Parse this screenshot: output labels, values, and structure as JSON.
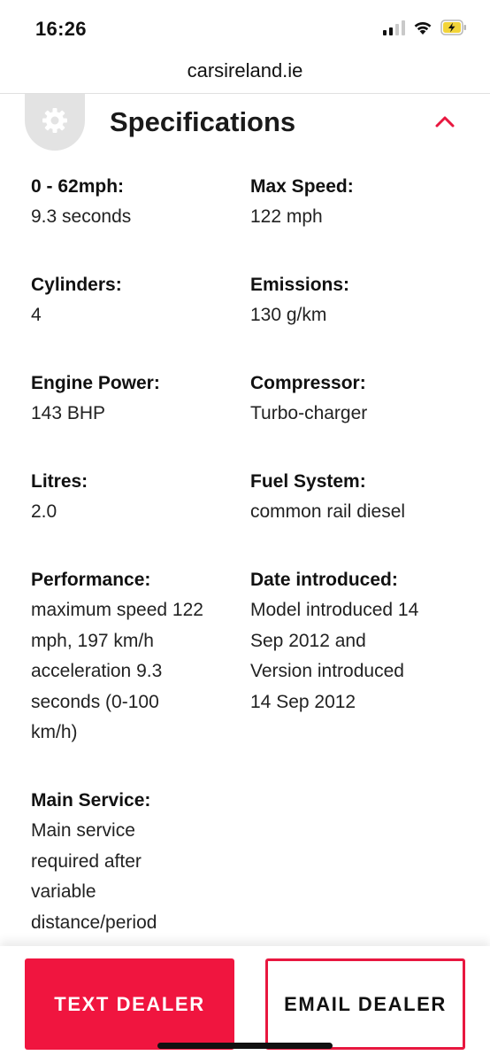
{
  "status_bar": {
    "time": "16:26"
  },
  "browser": {
    "url": "carsireland.ie"
  },
  "section": {
    "title": "Specifications",
    "icon": "gear-icon",
    "toggle_icon": "chevron-up-icon",
    "accent_color": "#e8173f"
  },
  "specs": [
    {
      "label": "0 - 62mph:",
      "value": [
        "9.3 seconds"
      ]
    },
    {
      "label": "Max Speed:",
      "value": [
        "122 mph"
      ]
    },
    {
      "label": "Cylinders:",
      "value": [
        "4"
      ]
    },
    {
      "label": "Emissions:",
      "value": [
        "130 g/km"
      ]
    },
    {
      "label": "Engine Power:",
      "value": [
        "143 BHP"
      ]
    },
    {
      "label": "Compressor:",
      "value": [
        "Turbo-charger"
      ]
    },
    {
      "label": "Litres:",
      "value": [
        "2.0"
      ]
    },
    {
      "label": "Fuel System:",
      "value": [
        "common rail diesel"
      ]
    },
    {
      "label": "Performance:",
      "value": [
        "maximum speed 122",
        "mph, 197 km/h",
        "acceleration 9.3",
        "seconds (0-100",
        "km/h)"
      ]
    },
    {
      "label": "Date introduced:",
      "value": [
        "Model introduced 14",
        "Sep 2012 and",
        "Version introduced",
        "14 Sep 2012"
      ]
    },
    {
      "label": "Main Service:",
      "value": [
        "Main service",
        "required after",
        "variable",
        "distance/period"
      ]
    }
  ],
  "actions": {
    "text_dealer": "TEXT DEALER",
    "email_dealer": "EMAIL DEALER",
    "primary_color": "#f0153f"
  }
}
